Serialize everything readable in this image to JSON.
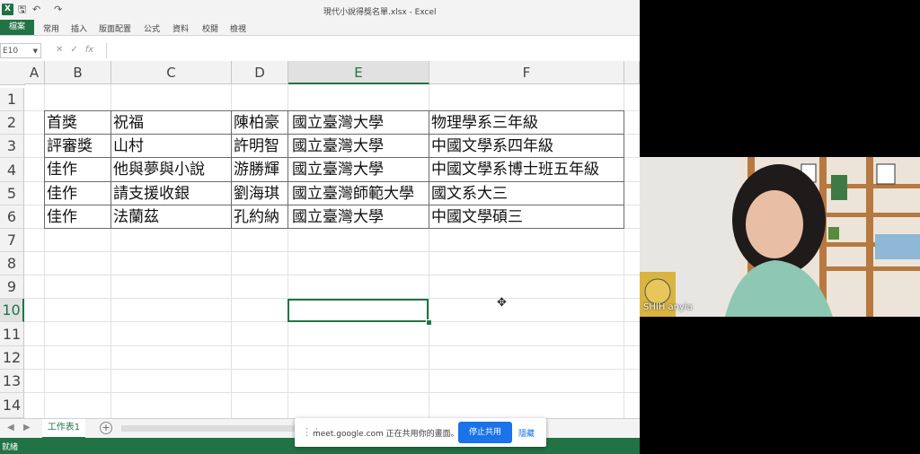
{
  "window": {
    "title": "現代小說得獎名單.xlsx - Excel",
    "xl_icon": "X",
    "quick_access": [
      "save-icon",
      "undo-icon",
      "redo-icon"
    ]
  },
  "ribbon": {
    "tabs": [
      "檔案",
      "常用",
      "插入",
      "版面配置",
      "公式",
      "資料",
      "校閱",
      "檢視"
    ]
  },
  "formula_bar": {
    "name_box": "E10",
    "fx": "fx",
    "value": ""
  },
  "columns": [
    "A",
    "B",
    "C",
    "D",
    "E",
    "F"
  ],
  "rows": [
    "1",
    "2",
    "3",
    "4",
    "5",
    "6",
    "7",
    "8",
    "9",
    "10",
    "11",
    "12",
    "13",
    "14"
  ],
  "selected_cell": "E10",
  "table": [
    {
      "b": "首獎",
      "c": "祝福",
      "d": "陳柏豪",
      "e": "國立臺灣大學",
      "f": "物理學系三年級"
    },
    {
      "b": "評審獎",
      "c": "山村",
      "d": "許明智",
      "e": "國立臺灣大學",
      "f": "中國文學系四年級"
    },
    {
      "b": "佳作",
      "c": "他與夢與小說",
      "d": "游勝輝",
      "e": "國立臺灣大學",
      "f": "中國文學系博士班五年級"
    },
    {
      "b": "佳作",
      "c": "請支援收銀",
      "d": "劉海琪",
      "e": "國立臺灣師範大學",
      "f": "國文系大三"
    },
    {
      "b": "佳作",
      "c": "法蘭茲",
      "d": "孔約納",
      "e": "國立臺灣大學",
      "f": "中國文學碩三"
    }
  ],
  "sheet_tabs": [
    "工作表1"
  ],
  "status": {
    "text": "就緒"
  },
  "share_bar": {
    "message": "meet.google.com 正在共用你的畫面。",
    "stop_label": "停止共用",
    "hide_label": "隱藏"
  },
  "video": {
    "participant": "SHIH anyia"
  },
  "colors": {
    "excel_green": "#217346",
    "meet_blue": "#1a73e8"
  }
}
